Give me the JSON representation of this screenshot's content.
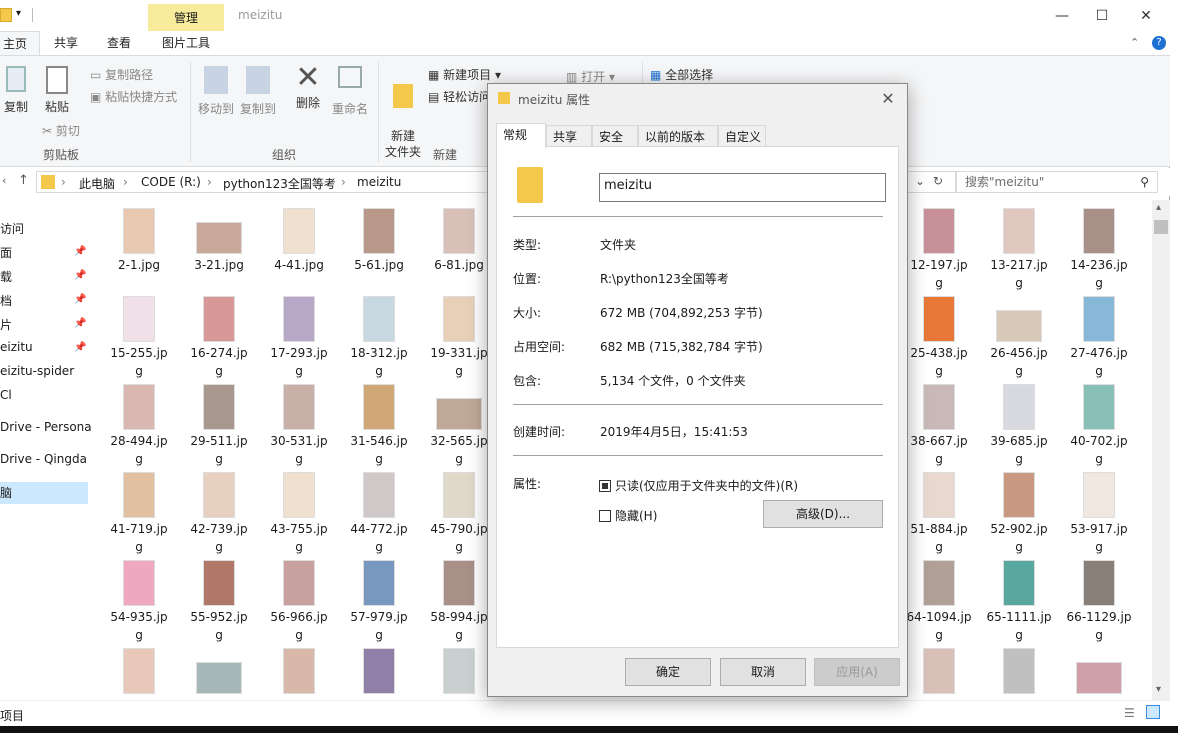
{
  "window": {
    "title": "meizitu",
    "context_tab": "管理"
  },
  "ribbon_tabs": [
    {
      "label": "主页",
      "active": true
    },
    {
      "label": "共享"
    },
    {
      "label": "查看"
    },
    {
      "label": "图片工具"
    }
  ],
  "ribbon": {
    "copy": "复制",
    "paste": "粘贴",
    "copy_path": "复制路径",
    "paste_shortcut": "粘贴快捷方式",
    "cut": "剪切",
    "clipboard_group": "剪贴板",
    "move_to": "移动到",
    "copy_to": "复制到",
    "delete": "删除",
    "rename": "重命名",
    "organize_group": "组织",
    "new_folder": "新建\n文件夹",
    "new_item": "新建项目",
    "easy_access": "轻松访问",
    "new_group": "新建",
    "open": "打开",
    "select_all": "全部选择"
  },
  "address": {
    "crumbs": [
      "此电脑",
      "CODE (R:)",
      "python123全国等考",
      "meizitu"
    ],
    "search_placeholder": "搜索\"meizitu\""
  },
  "nav_pane": [
    {
      "label": "访问",
      "pinned": false
    },
    {
      "label": "面",
      "pinned": true
    },
    {
      "label": "载",
      "pinned": true
    },
    {
      "label": "档",
      "pinned": true
    },
    {
      "label": "片",
      "pinned": true
    },
    {
      "label": "eizitu",
      "pinned": true
    },
    {
      "label": "eizitu-spider",
      "pinned": false
    },
    {
      "label": "Cl",
      "pinned": false
    },
    {
      "label": "Drive - Persona",
      "pinned": false
    },
    {
      "label": "Drive - Qingda",
      "pinned": false
    },
    {
      "label": "脑",
      "pinned": false,
      "selected": true
    }
  ],
  "files": [
    [
      "2-1.jpg",
      "3-21.jpg",
      "4-41.jpg",
      "5-61.jpg",
      "6-81.jpg",
      "12-197.jp\ng",
      "13-217.jp\ng",
      "14-236.jp\ng"
    ],
    [
      "15-255.jp\ng",
      "16-274.jp\ng",
      "17-293.jp\ng",
      "18-312.jp\ng",
      "19-331.jp\ng",
      "25-438.jp\ng",
      "26-456.jp\ng",
      "27-476.jp\ng"
    ],
    [
      "28-494.jp\ng",
      "29-511.jp\ng",
      "30-531.jp\ng",
      "31-546.jp\ng",
      "32-565.jp\ng",
      "38-667.jp\ng",
      "39-685.jp\ng",
      "40-702.jp\ng"
    ],
    [
      "41-719.jp\ng",
      "42-739.jp\ng",
      "43-755.jp\ng",
      "44-772.jp\ng",
      "45-790.jp\ng",
      "51-884.jp\ng",
      "52-902.jp\ng",
      "53-917.jp\ng"
    ],
    [
      "54-935.jp\ng",
      "55-952.jp\ng",
      "56-966.jp\ng",
      "57-979.jp\ng",
      "58-994.jp\ng",
      "64-1094.jp\ng",
      "65-1111.jp\ng",
      "66-1129.jp\ng"
    ],
    [
      "",
      "",
      "",
      "",
      "",
      "",
      "",
      ""
    ]
  ],
  "statusbar": {
    "left": "项目"
  },
  "dialog": {
    "title": "meizitu 属性",
    "tabs": [
      "常规",
      "共享",
      "安全",
      "以前的版本",
      "自定义"
    ],
    "name": "meizitu",
    "props": {
      "type_label": "类型:",
      "type_value": "文件夹",
      "location_label": "位置:",
      "location_value": "R:\\python123全国等考",
      "size_label": "大小:",
      "size_value": "672 MB (704,892,253 字节)",
      "disk_label": "占用空间:",
      "disk_value": "682 MB (715,382,784 字节)",
      "contains_label": "包含:",
      "contains_value": "5,134 个文件，0 个文件夹",
      "created_label": "创建时间:",
      "created_value": "2019年4月5日，15:41:53",
      "attr_label": "属性:"
    },
    "readonly_label": "只读(仅应用于文件夹中的文件)(R)",
    "hidden_label": "隐藏(H)",
    "advanced_button": "高级(D)...",
    "ok_button": "确定",
    "cancel_button": "取消",
    "apply_button": "应用(A)"
  }
}
